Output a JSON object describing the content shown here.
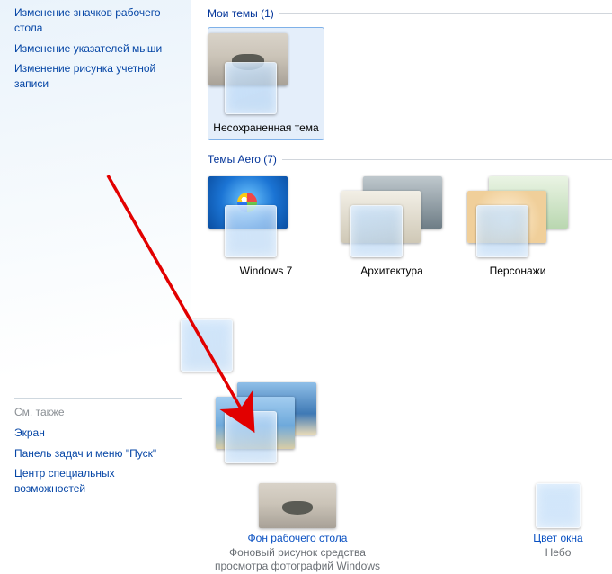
{
  "sidebar": {
    "links": [
      "Изменение значков рабочего стола",
      "Изменение указателей мыши",
      "Изменение рисунка учетной записи"
    ],
    "see_also_label": "См. также",
    "bottom_links": [
      "Экран",
      "Панель задач и меню \"Пуск\"",
      "Центр специальных возможностей"
    ]
  },
  "sections": {
    "my_themes": {
      "title": "Мои темы (1)"
    },
    "aero_themes": {
      "title": "Темы Aero (7)"
    }
  },
  "my_themes": [
    {
      "label": "Несохраненная тема"
    }
  ],
  "aero_themes": [
    {
      "label": "Windows 7"
    },
    {
      "label": "Архитектура"
    },
    {
      "label": "Персонажи"
    },
    {
      "label": ""
    },
    {
      "label": ""
    }
  ],
  "bottom": {
    "bg": {
      "link": "Фон рабочего стола",
      "desc": "Фоновый рисунок средства просмотра фотографий Windows"
    },
    "color": {
      "link": "Цвет окна",
      "desc": "Небо"
    }
  }
}
